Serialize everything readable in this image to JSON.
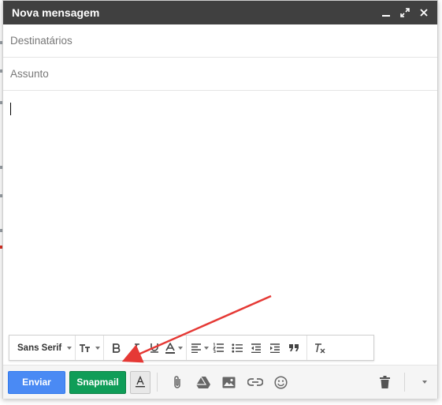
{
  "window": {
    "title": "Nova mensagem"
  },
  "fields": {
    "to_placeholder": "Destinatários",
    "subject_placeholder": "Assunto"
  },
  "format_toolbar": {
    "font_label": "Sans Serif"
  },
  "actions": {
    "send_label": "Enviar",
    "snapmail_label": "Snapmail"
  },
  "icons": {
    "minimize": "minimize-icon",
    "expand": "expand-icon",
    "close": "close-icon",
    "attach": "paperclip-icon",
    "drive": "drive-icon",
    "photo": "photo-icon",
    "link": "link-icon",
    "emoji": "emoji-icon",
    "trash": "trash-icon",
    "more": "chevron-down-icon"
  },
  "colors": {
    "titlebar": "#404040",
    "send": "#4a8af4",
    "snapmail": "#0f9d58",
    "annotation_arrow": "#e53935"
  }
}
